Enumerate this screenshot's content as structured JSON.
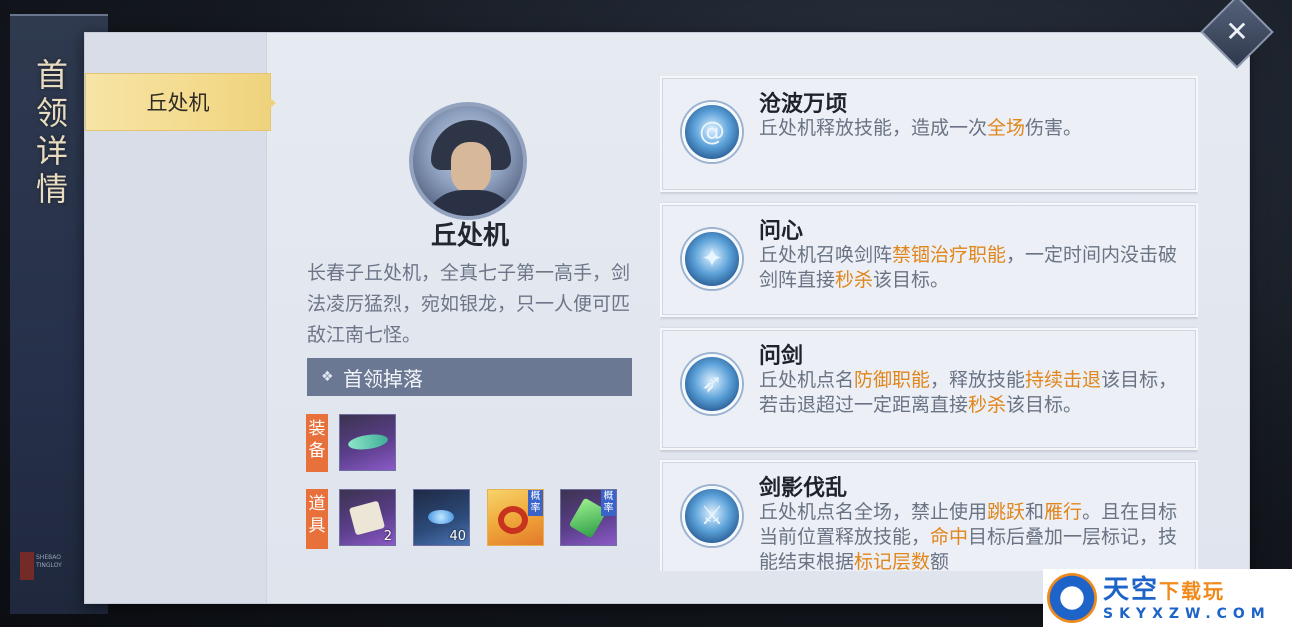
{
  "title": "首领详情",
  "seal_text": "SHEBAO TINGLOY",
  "close_icon": "close-icon",
  "tabs": [
    {
      "label": "丘处机",
      "active": true
    }
  ],
  "boss": {
    "name": "丘处机",
    "description": "长春子丘处机，全真七子第一高手，剑法凌厉猛烈，宛如银龙，只一人便可匹敌江南七怪。"
  },
  "drops": {
    "header": "首领掉落",
    "categories": [
      {
        "label": "装备",
        "items": [
          {
            "icon": "green-jade-item-icon",
            "rarity": "purple",
            "qty": "",
            "prob": ""
          }
        ]
      },
      {
        "label": "道具",
        "items": [
          {
            "icon": "scroll-item-icon",
            "rarity": "purple",
            "qty": "2",
            "prob": ""
          },
          {
            "icon": "blue-crystal-item-icon",
            "rarity": "blue",
            "qty": "40",
            "prob": ""
          },
          {
            "icon": "red-ring-item-icon",
            "rarity": "gold",
            "qty": "",
            "prob": "概率"
          },
          {
            "icon": "green-gem-item-icon",
            "rarity": "purple",
            "qty": "",
            "prob": "概率"
          }
        ]
      }
    ]
  },
  "skills": [
    {
      "name": "沧波万顷",
      "icon": "wave-swirl-icon",
      "desc": [
        {
          "t": "丘处机释放技能，造成一次"
        },
        {
          "t": "全场",
          "hl": true
        },
        {
          "t": "伤害。"
        }
      ]
    },
    {
      "name": "问心",
      "icon": "sword-formation-icon",
      "desc": [
        {
          "t": "丘处机召唤剑阵"
        },
        {
          "t": "禁锢治疗职能",
          "hl": true
        },
        {
          "t": "，一定时间内没击破剑阵直接"
        },
        {
          "t": "秒杀",
          "hl": true
        },
        {
          "t": "该目标。"
        }
      ]
    },
    {
      "name": "问剑",
      "icon": "sword-strike-icon",
      "desc": [
        {
          "t": "丘处机点名"
        },
        {
          "t": "防御职能",
          "hl": true
        },
        {
          "t": "，释放技能"
        },
        {
          "t": "持续击退",
          "hl": true
        },
        {
          "t": "该目标，若击退超过一定距离直接"
        },
        {
          "t": "秒杀",
          "hl": true
        },
        {
          "t": "该目标。"
        }
      ]
    },
    {
      "name": "剑影伐乱",
      "icon": "sword-shadow-icon",
      "desc": [
        {
          "t": "丘处机点名全场，禁止使用"
        },
        {
          "t": "跳跃",
          "hl": true
        },
        {
          "t": "和"
        },
        {
          "t": "雁行",
          "hl": true
        },
        {
          "t": "。且在目标当前位置释放技能，"
        },
        {
          "t": "命中",
          "hl": true
        },
        {
          "t": "目标后叠加一层标记，技能结束根据"
        },
        {
          "t": "标记层数",
          "hl": true
        },
        {
          "t": "额"
        }
      ]
    }
  ],
  "watermark": {
    "cn_main": "天空",
    "cn_sub": "下载玩",
    "en": "SKYXZW.COM"
  }
}
